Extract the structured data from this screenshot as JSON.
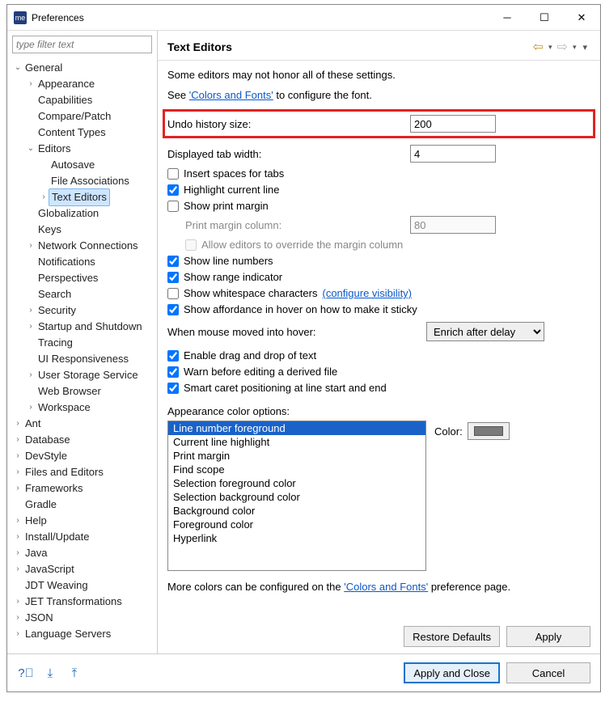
{
  "window": {
    "title": "Preferences"
  },
  "filter": {
    "placeholder": "type filter text"
  },
  "tree": [
    {
      "d": 0,
      "t": "expanded",
      "label": "General"
    },
    {
      "d": 1,
      "t": "child",
      "label": "Appearance"
    },
    {
      "d": 1,
      "t": "none",
      "label": "Capabilities"
    },
    {
      "d": 1,
      "t": "none",
      "label": "Compare/Patch"
    },
    {
      "d": 1,
      "t": "none",
      "label": "Content Types"
    },
    {
      "d": 1,
      "t": "expanded",
      "label": "Editors"
    },
    {
      "d": 2,
      "t": "none",
      "label": "Autosave"
    },
    {
      "d": 2,
      "t": "none",
      "label": "File Associations"
    },
    {
      "d": 2,
      "t": "child",
      "label": "Text Editors",
      "sel": true
    },
    {
      "d": 1,
      "t": "none",
      "label": "Globalization"
    },
    {
      "d": 1,
      "t": "none",
      "label": "Keys"
    },
    {
      "d": 1,
      "t": "child",
      "label": "Network Connections"
    },
    {
      "d": 1,
      "t": "none",
      "label": "Notifications"
    },
    {
      "d": 1,
      "t": "none",
      "label": "Perspectives"
    },
    {
      "d": 1,
      "t": "none",
      "label": "Search"
    },
    {
      "d": 1,
      "t": "child",
      "label": "Security"
    },
    {
      "d": 1,
      "t": "child",
      "label": "Startup and Shutdown"
    },
    {
      "d": 1,
      "t": "none",
      "label": "Tracing"
    },
    {
      "d": 1,
      "t": "none",
      "label": "UI Responsiveness"
    },
    {
      "d": 1,
      "t": "child",
      "label": "User Storage Service"
    },
    {
      "d": 1,
      "t": "none",
      "label": "Web Browser"
    },
    {
      "d": 1,
      "t": "child",
      "label": "Workspace"
    },
    {
      "d": 0,
      "t": "child",
      "label": "Ant"
    },
    {
      "d": 0,
      "t": "child",
      "label": "Database"
    },
    {
      "d": 0,
      "t": "child",
      "label": "DevStyle"
    },
    {
      "d": 0,
      "t": "child",
      "label": "Files and Editors"
    },
    {
      "d": 0,
      "t": "child",
      "label": "Frameworks"
    },
    {
      "d": 0,
      "t": "none",
      "label": "Gradle"
    },
    {
      "d": 0,
      "t": "child",
      "label": "Help"
    },
    {
      "d": 0,
      "t": "child",
      "label": "Install/Update"
    },
    {
      "d": 0,
      "t": "child",
      "label": "Java"
    },
    {
      "d": 0,
      "t": "child",
      "label": "JavaScript"
    },
    {
      "d": 0,
      "t": "none",
      "label": "JDT Weaving"
    },
    {
      "d": 0,
      "t": "child",
      "label": "JET Transformations"
    },
    {
      "d": 0,
      "t": "child",
      "label": "JSON"
    },
    {
      "d": 0,
      "t": "child",
      "label": "Language Servers"
    }
  ],
  "page": {
    "title": "Text Editors",
    "intro": "Some editors may not honor all of these settings.",
    "see_prefix": "See ",
    "see_link": "'Colors and Fonts'",
    "see_suffix": " to configure the font.",
    "undo_label": "Undo history size:",
    "undo_value": "200",
    "tab_label": "Displayed tab width:",
    "tab_value": "4",
    "insert_spaces": "Insert spaces for tabs",
    "highlight_line": "Highlight current line",
    "show_print_margin": "Show print margin",
    "print_margin_col_label": "Print margin column:",
    "print_margin_col_value": "80",
    "allow_override": "Allow editors to override the margin column",
    "show_line_numbers": "Show line numbers",
    "show_range": "Show range indicator",
    "show_ws": "Show whitespace characters ",
    "show_ws_link": "(configure visibility)",
    "show_affordance": "Show affordance in hover on how to make it sticky",
    "hover_label": "When mouse moved into hover:",
    "hover_value": "Enrich after delay",
    "enable_dnd": "Enable drag and drop of text",
    "warn_derived": "Warn before editing a derived file",
    "smart_caret": "Smart caret positioning at line start and end",
    "color_options_label": "Appearance color options:",
    "color_label": "Color:",
    "color_items": [
      "Line number foreground",
      "Current line highlight",
      "Print margin",
      "Find scope",
      "Selection foreground color",
      "Selection background color",
      "Background color",
      "Foreground color",
      "Hyperlink"
    ],
    "more_prefix": "More colors can be configured on the ",
    "more_link": "'Colors and Fonts'",
    "more_suffix": " preference page."
  },
  "buttons": {
    "restore": "Restore Defaults",
    "apply": "Apply",
    "apply_close": "Apply and Close",
    "cancel": "Cancel"
  }
}
